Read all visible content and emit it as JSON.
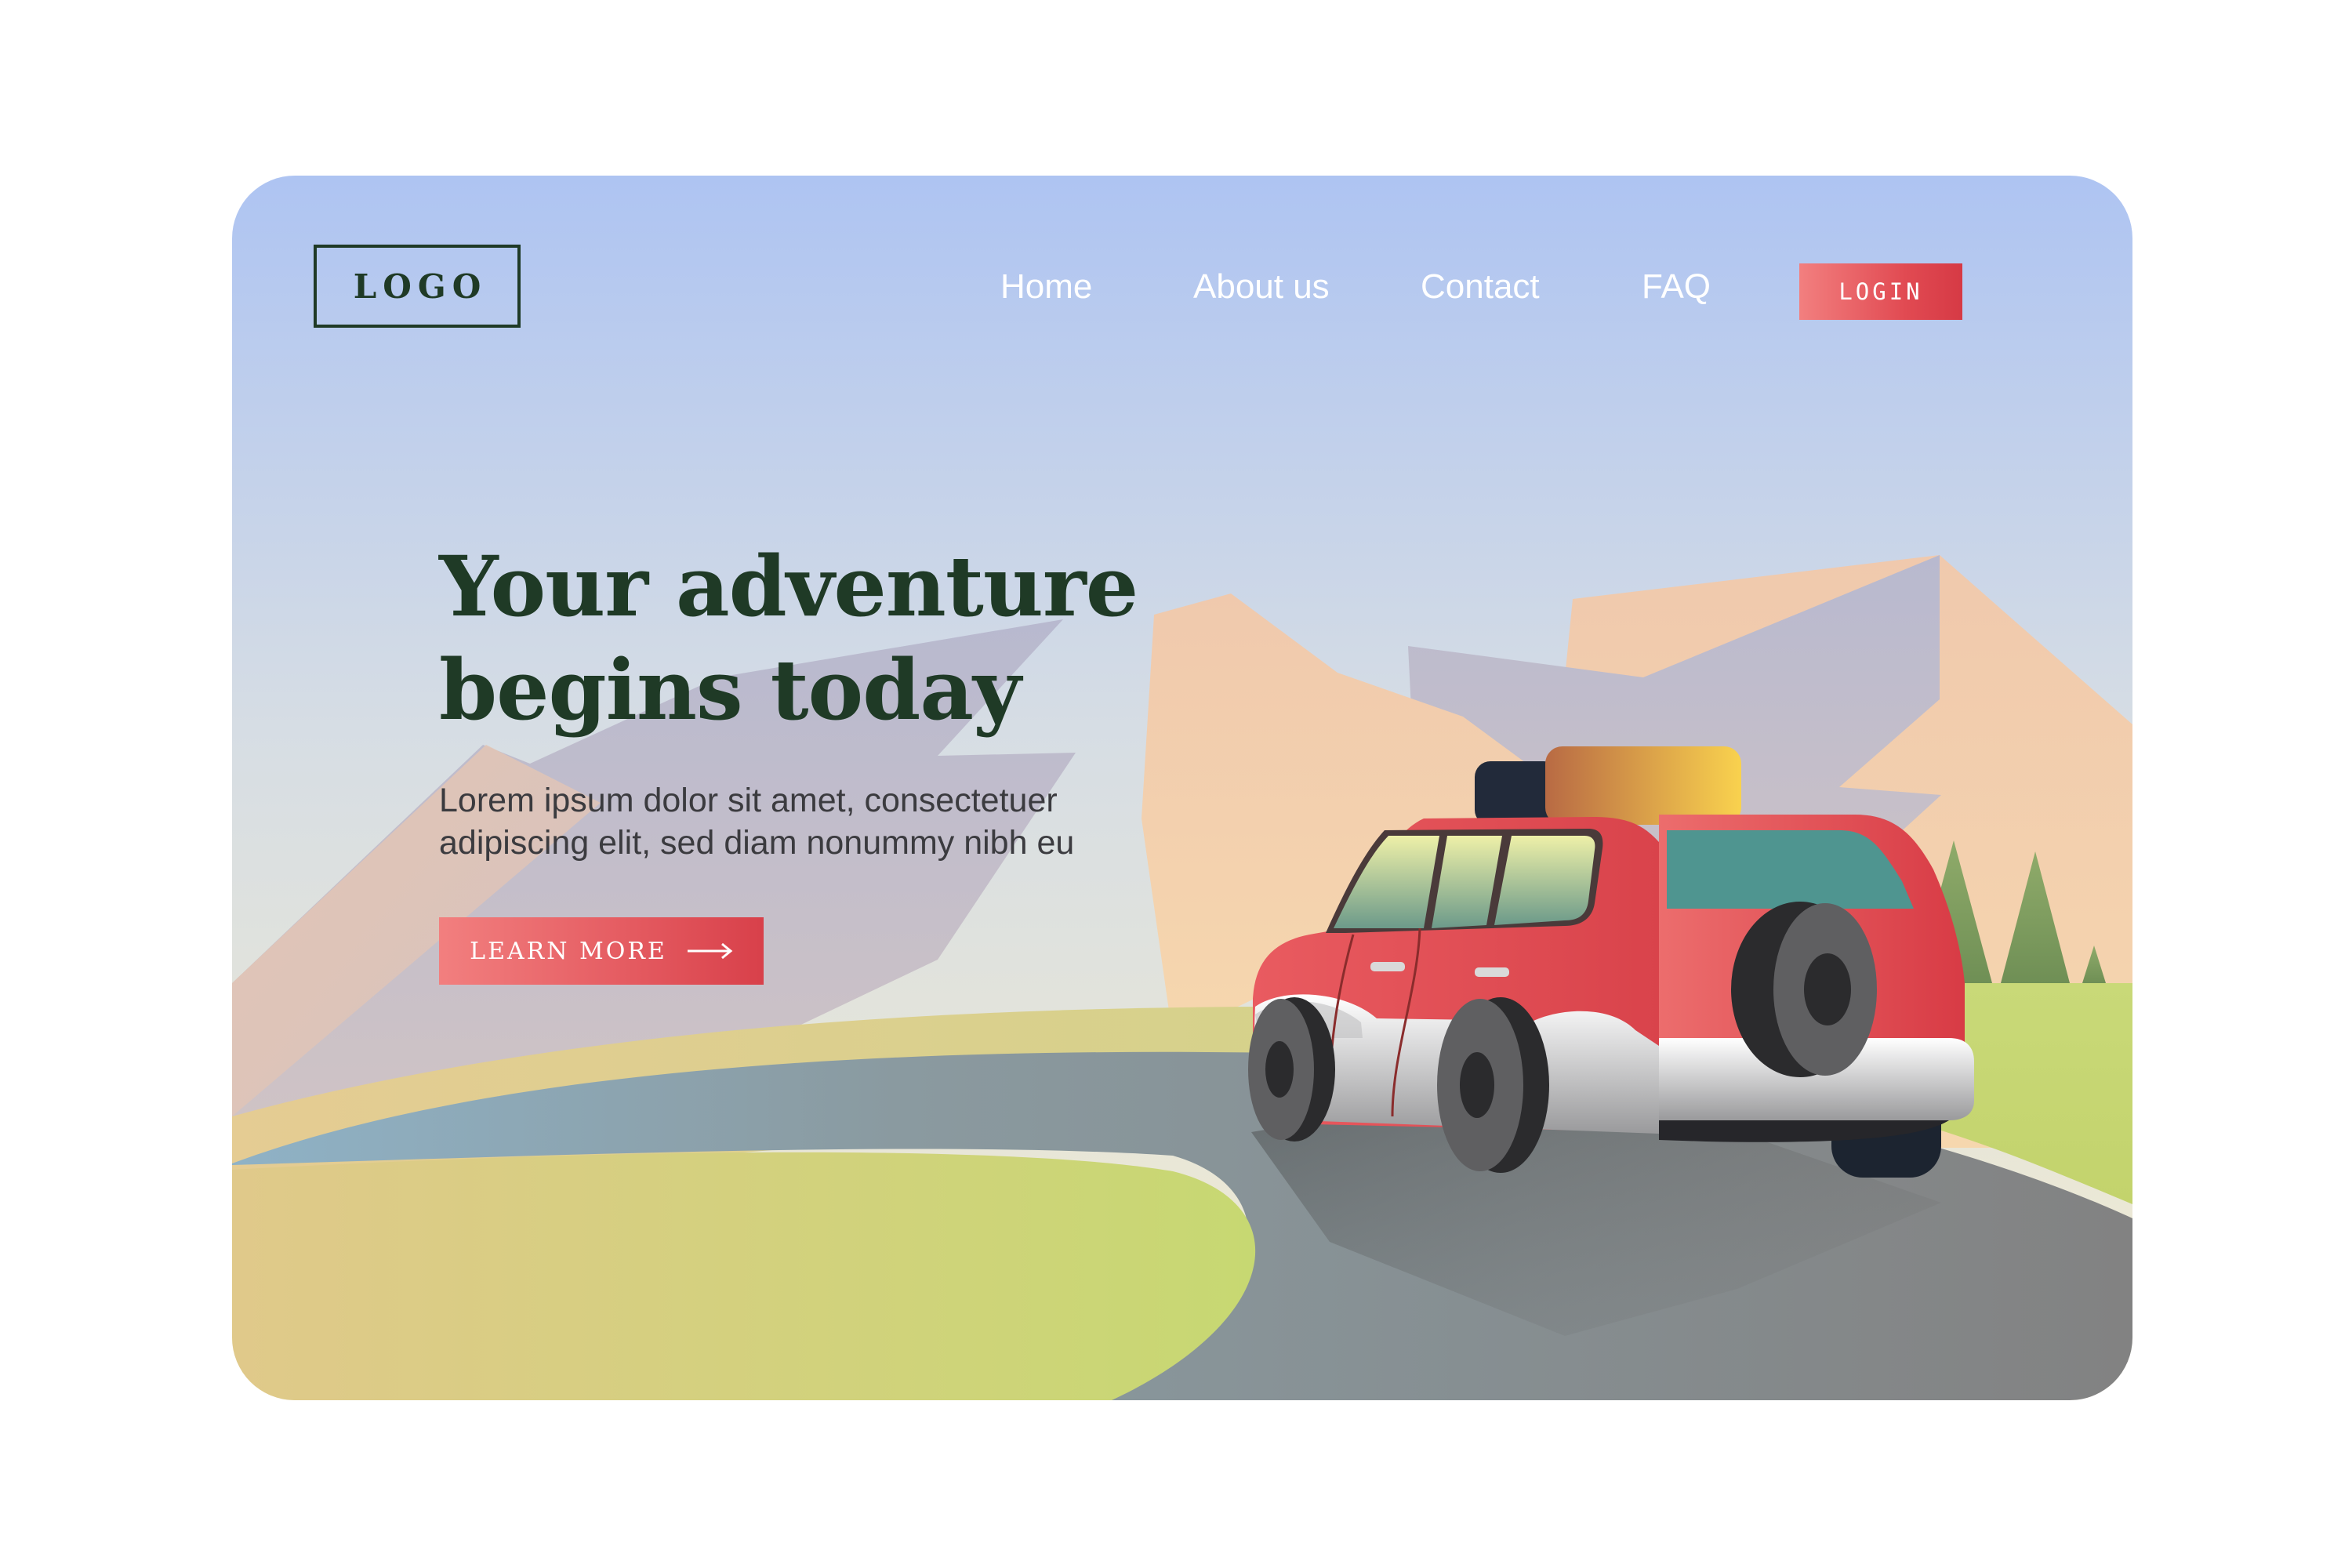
{
  "header": {
    "logo_text": "LOGO",
    "nav": [
      {
        "label": "Home"
      },
      {
        "label": "About us"
      },
      {
        "label": "Contact"
      },
      {
        "label": "FAQ"
      }
    ],
    "login_label": "LOGIN"
  },
  "hero": {
    "title_lines": [
      "Your adventure",
      "begins today"
    ],
    "subtitle_lines": [
      "Lorem ipsum dolor sit amet, consectetuer",
      "adipiscing elit, sed diam nonummy nibh eu"
    ],
    "cta_label": "LEARN MORE",
    "cta_icon": "arrow-right-icon"
  },
  "illustration": {
    "elements": [
      "mountains",
      "road",
      "red-suv",
      "pine-trees",
      "grass-hills"
    ]
  },
  "colors": {
    "accent": "#e14a52",
    "heading": "#1f3a26",
    "sky_top": "#aec4f2",
    "sky_bottom": "#f3ecd0",
    "car_body": "#e44f56",
    "grass": "#c7d872",
    "road": "#858585"
  }
}
